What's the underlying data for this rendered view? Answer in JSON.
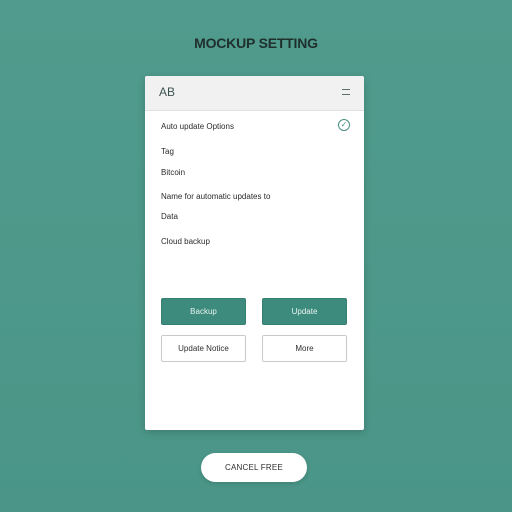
{
  "screen": {
    "title": "MOCKUP SETTING"
  },
  "card": {
    "header_title": "AB",
    "items": [
      "Auto update Options",
      "Tag",
      "Bitcoin",
      "Name for automatic updates to",
      "Data",
      "Cloud backup"
    ],
    "buttons": {
      "primary_left": "Backup",
      "primary_right": "Update",
      "secondary_left": "Update Notice",
      "secondary_right": "More"
    }
  },
  "bottom_action": {
    "label": "CANCEL FREE"
  },
  "colors": {
    "background": "#4e9a8c",
    "accent": "#3d8b7d",
    "card": "#ffffff"
  }
}
